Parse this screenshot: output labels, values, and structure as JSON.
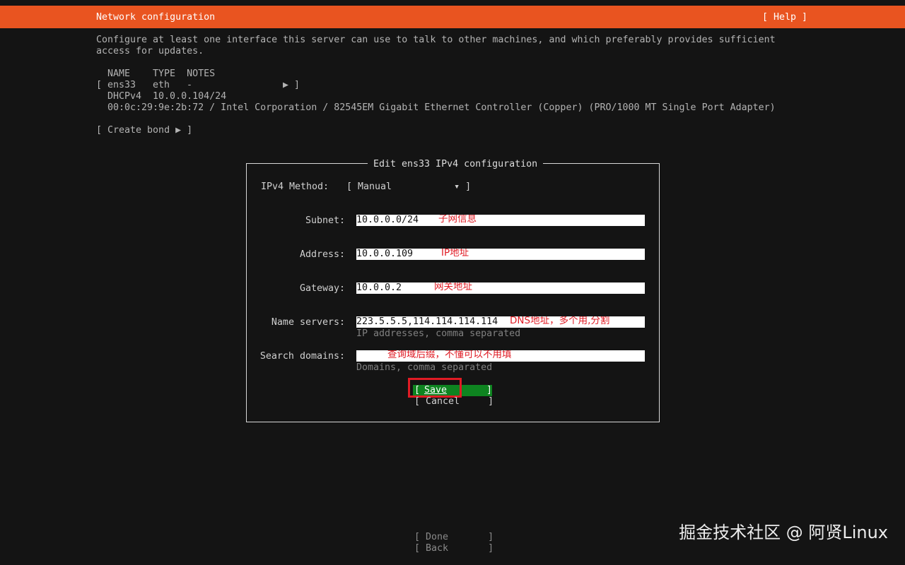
{
  "header": {
    "title": "Network configuration",
    "help": "[ Help ]"
  },
  "intro": {
    "line1": "Configure at least one interface this server can use to talk to other machines, and which preferably provides sufficient",
    "line2": "access for updates."
  },
  "interfaces": {
    "columns": "NAME    TYPE  NOTES",
    "row_open": "[",
    "row_name": "ens33",
    "row_type": "eth",
    "row_notes": "-",
    "row_arrow": "▶ ]",
    "dhcp": "DHCPv4  10.0.0.104/24",
    "hw": "00:0c:29:9e:2b:72 / Intel Corporation / 82545EM Gigabit Ethernet Controller (Copper) (PRO/1000 MT Single Port Adapter)"
  },
  "create_bond": "[ Create bond ▶ ]",
  "dialog": {
    "title": "Edit ens33 IPv4 configuration",
    "method_label": "IPv4 Method:",
    "method_value": "[ Manual           ▾ ]",
    "subnet_label": "Subnet:",
    "subnet_value": "10.0.0.0/24",
    "subnet_note": "子网信息",
    "address_label": "Address:",
    "address_value": "10.0.0.109",
    "address_note": "IP地址",
    "gateway_label": "Gateway:",
    "gateway_value": "10.0.0.2",
    "gateway_note": "网关地址",
    "ns_label": "Name servers:",
    "ns_value": "223.5.5.5,114.114.114.114",
    "ns_note": "DNS地址，多个用,分割",
    "ns_help": "IP addresses, comma separated",
    "sd_label": "Search domains:",
    "sd_value": "",
    "sd_note": "查询域后缀，不懂可以不用填",
    "sd_help": "Domains, comma separated",
    "save_open": "[ ",
    "save_label": "Save",
    "save_close": "]",
    "cancel_label": "[ Cancel     ]"
  },
  "footer": {
    "done": "[ Done       ]",
    "back": "[ Back       ]"
  },
  "watermark": "掘金技术社区 @ 阿贤Linux",
  "colors": {
    "accent": "#e95420",
    "button_focus": "#0e8420",
    "annotation": "#e01b24"
  }
}
